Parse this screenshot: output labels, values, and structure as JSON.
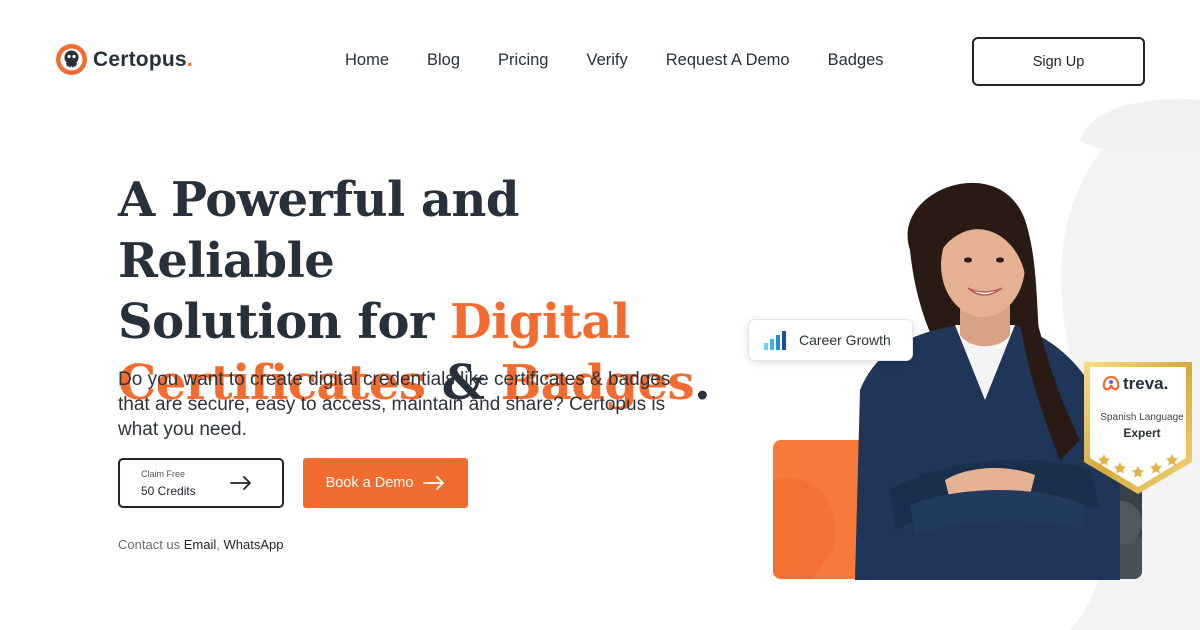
{
  "brand": {
    "name": "Certopus",
    "dot": ".",
    "accent": "#f26b2f"
  },
  "nav": {
    "items": [
      "Home",
      "Blog",
      "Pricing",
      "Verify",
      "Request A Demo",
      "Badges"
    ],
    "signup_label": "Sign Up"
  },
  "hero": {
    "line1": "A Powerful and Reliable",
    "line2_prefix": "Solution for ",
    "line2_highlight": "Digital",
    "line3_highlight1": "Certificates",
    "line3_amp": " & ",
    "line3_highlight2": "Badges",
    "line3_end": ".",
    "subtitle": "Do you want to create digital credentials like certificates & badges that are secure, easy to access, maintain and share? Certopus is what you need."
  },
  "cta": {
    "claim_small": "Claim Free",
    "claim_big": "50 Credits",
    "demo_label": "Book a Demo"
  },
  "contact": {
    "prefix": "Contact us ",
    "email": "Email",
    "sep": ", ",
    "whatsapp": "WhatsApp"
  },
  "visual": {
    "chip_label": "Career Growth",
    "badge_brand": "treva.",
    "badge_sub": "Spanish Language",
    "badge_main": "Expert"
  },
  "colors": {
    "orange": "#f26b2f",
    "dark": "#27313b"
  }
}
